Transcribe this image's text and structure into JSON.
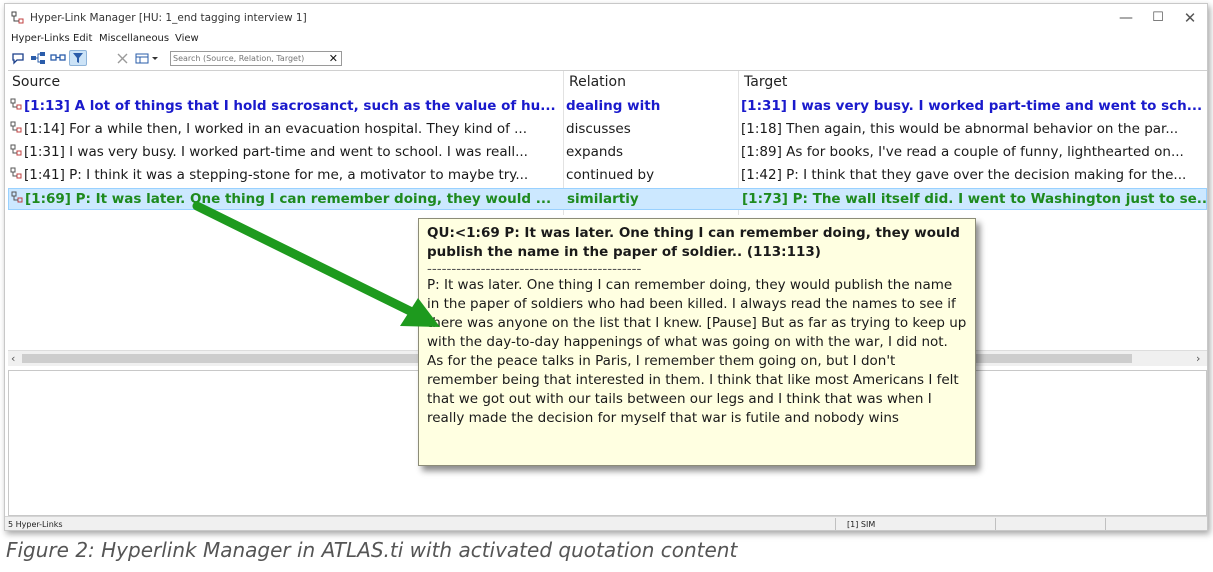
{
  "window": {
    "title": "Hyper-Link Manager [HU: 1_end tagging interview 1]",
    "controls": {
      "minimize": "—",
      "maximize": "☐",
      "close": "✕"
    }
  },
  "menu": [
    "Hyper-Links",
    "Edit",
    "Miscellaneous",
    "View"
  ],
  "toolbar": {
    "search_placeholder": "Search (Source, Relation, Target)",
    "clear_label": "✕",
    "buttons": [
      "speech-bubble-icon",
      "tree-link-icon",
      "link-chain-icon",
      "filter-icon",
      "delete-icon",
      "table-view-icon"
    ]
  },
  "list": {
    "columns": [
      "Source",
      "Relation",
      "Target"
    ],
    "rows": [
      {
        "source": "[1:13] A lot of things that I hold sacrosanct, such as the value of hu...",
        "relation": "dealing with",
        "target": "[1:31] I was very busy. I worked part-time and went to sch...",
        "style": "blue"
      },
      {
        "source": "[1:14] For a while then, I worked in an evacuation hospital. They kind of ...",
        "relation": "discusses",
        "target": "[1:18] Then again, this would be abnormal behavior on the par...",
        "style": "normal"
      },
      {
        "source": "[1:31] I was very busy. I worked part-time and went to school. I was reall...",
        "relation": "expands",
        "target": "[1:89] As for books, I've read a couple of funny, lighthearted on...",
        "style": "normal"
      },
      {
        "source": "[1:41] P: I think it was a stepping-stone for me, a motivator to maybe try...",
        "relation": "continued by",
        "target": "[1:42] P: I think that they gave over the decision making for the...",
        "style": "normal"
      },
      {
        "source": "[1:69] P: It was later. One thing I can remember doing, they would ...",
        "relation": "similartiy",
        "target": "[1:73] P: The wall itself did. I went to Washington just to se...",
        "style": "green",
        "selected": true
      }
    ]
  },
  "tooltip": {
    "header": "QU:<1:69 P: It was later. One thing I can remember doing, they would publish the name in the paper of soldier.. (113:113)",
    "separator": "--------------------------------------------",
    "body": "P:   It was later. One thing I can remember doing, they would publish the name in the paper of soldiers who had been killed. I always read the names to see if there was anyone on the list that I knew. [Pause] But as far as trying to keep up with the day-to-day happenings of what was going on with the war, I did not. As for the peace talks in Paris, I remember them going on, but I don't remember being that interested in them. I think that like most Americans I felt that we got out with our tails between our legs and I think that was when I really made the decision for myself that war is futile and nobody wins"
  },
  "statusbar": {
    "left": "5 Hyper-Links",
    "right": "[1] SIM"
  },
  "caption": "Figure 2:  Hyperlink Manager in ATLAS.ti with activated quotation content",
  "colors": {
    "link_blue": "#1a1acc",
    "link_green": "#1e8a1e",
    "selection": "#cce8ff",
    "tooltip_bg": "#ffffe1",
    "arrow": "#1e9a1e"
  }
}
